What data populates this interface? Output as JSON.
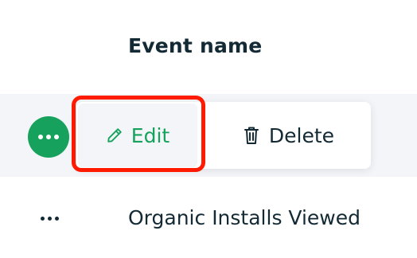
{
  "table": {
    "header": {
      "event_name": "Event name"
    },
    "rows": [
      {
        "event_name": "Organic Installs Viewed"
      }
    ]
  },
  "actions_menu": {
    "edit_label": "Edit",
    "delete_label": "Delete",
    "edit_icon": "pencil-icon",
    "delete_icon": "trash-icon"
  },
  "colors": {
    "accent": "#16a25c",
    "highlight": "#ff1a00",
    "text": "#132a35",
    "row_hover": "#f3f5f8"
  }
}
